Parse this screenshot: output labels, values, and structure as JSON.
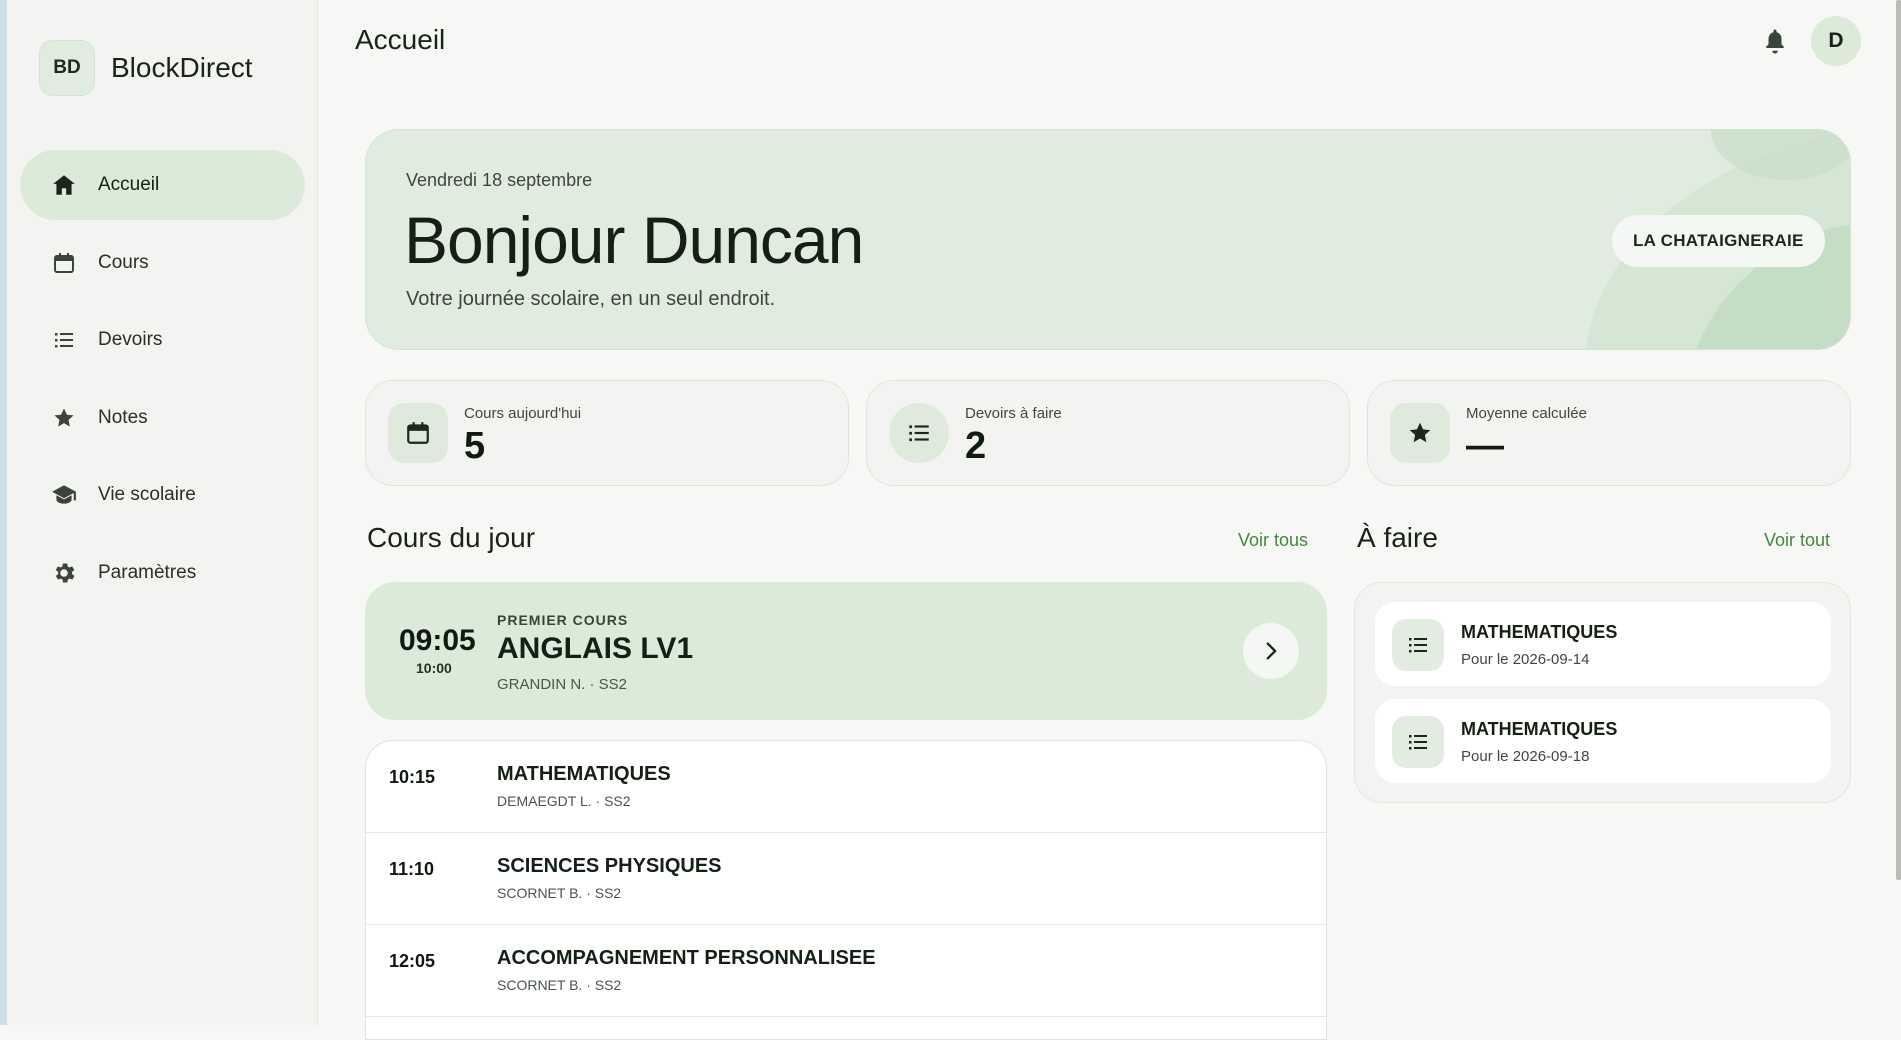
{
  "brand": {
    "initials": "BD",
    "name": "BlockDirect"
  },
  "nav": [
    {
      "label": "Accueil",
      "icon": "home-icon",
      "active": true
    },
    {
      "label": "Cours",
      "icon": "calendar-icon"
    },
    {
      "label": "Devoirs",
      "icon": "list-icon"
    },
    {
      "label": "Notes",
      "icon": "star-icon"
    },
    {
      "label": "Vie scolaire",
      "icon": "graduation-cap-icon"
    },
    {
      "label": "Paramètres",
      "icon": "gear-icon"
    }
  ],
  "topbar": {
    "title": "Accueil",
    "avatar_initial": "D"
  },
  "hero": {
    "date": "Vendredi 18 septembre",
    "greeting": "Bonjour Duncan",
    "subtitle": "Votre journée scolaire, en un seul endroit.",
    "school": "LA CHATAIGNERAIE"
  },
  "stats": [
    {
      "label": "Cours aujourd'hui",
      "value": "5",
      "icon": "calendar-icon"
    },
    {
      "label": "Devoirs à faire",
      "value": "2",
      "icon": "list-icon"
    },
    {
      "label": "Moyenne calculée",
      "value": "—",
      "icon": "star-icon"
    }
  ],
  "courses_section": {
    "title": "Cours du jour",
    "link": "Voir tous"
  },
  "first_course": {
    "start": "09:05",
    "end": "10:00",
    "kicker": "PREMIER COURS",
    "title": "ANGLAIS LV1",
    "meta": "GRANDIN N. · SS2"
  },
  "courses": [
    {
      "time": "10:15",
      "title": "MATHEMATIQUES",
      "meta": "DEMAEGDT L. · SS2"
    },
    {
      "time": "11:10",
      "title": "SCIENCES PHYSIQUES",
      "meta": "SCORNET B. · SS2"
    },
    {
      "time": "12:05",
      "title": "ACCOMPAGNEMENT PERSONNALISEE",
      "meta": "SCORNET B. · SS2"
    }
  ],
  "todo_section": {
    "title": "À faire",
    "link": "Voir tout"
  },
  "todos": [
    {
      "title": "MATHEMATIQUES",
      "due": "Pour le 2026-09-14"
    },
    {
      "title": "MATHEMATIQUES",
      "due": "Pour le 2026-09-18"
    }
  ],
  "colors": {
    "accent": "#3f8a3a",
    "active_bg": "#dcebd9",
    "hero_bg": "#e0ece0"
  }
}
